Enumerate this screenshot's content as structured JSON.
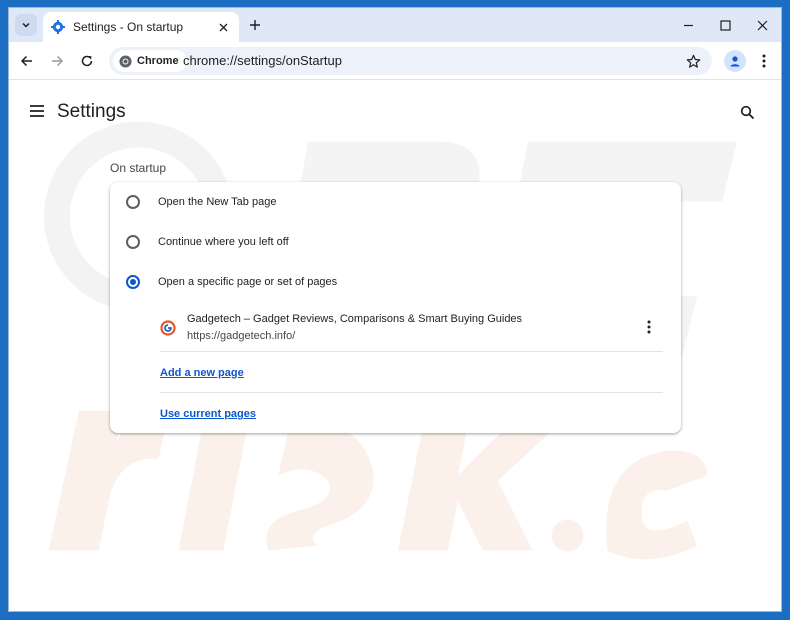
{
  "tab": {
    "title": "Settings - On startup"
  },
  "omnibox": {
    "chip_label": "Chrome",
    "url": "chrome://settings/onStartup"
  },
  "settings": {
    "title": "Settings",
    "section_title": "On startup",
    "options": [
      {
        "label": "Open the New Tab page",
        "checked": false
      },
      {
        "label": "Continue where you left off",
        "checked": false
      },
      {
        "label": "Open a specific page or set of pages",
        "checked": true
      }
    ],
    "startup_page": {
      "name": "Gadgetech – Gadget Reviews, Comparisons & Smart Buying Guides",
      "url": "https://gadgetech.info/"
    },
    "add_page_label": "Add a new page",
    "use_current_label": "Use current pages"
  },
  "colors": {
    "accent": "#0b57d0",
    "frame": "#dfe8f7",
    "desktop": "#1b6ec2"
  },
  "icons": [
    "tab-search-icon",
    "settings-gear-icon",
    "close-icon",
    "plus-icon",
    "minimize-icon",
    "maximize-icon",
    "back-arrow-icon",
    "forward-arrow-icon",
    "reload-icon",
    "chrome-logo-icon",
    "star-icon",
    "profile-icon",
    "kebab-menu-icon",
    "hamburger-icon",
    "search-icon",
    "site-favicon-icon"
  ]
}
